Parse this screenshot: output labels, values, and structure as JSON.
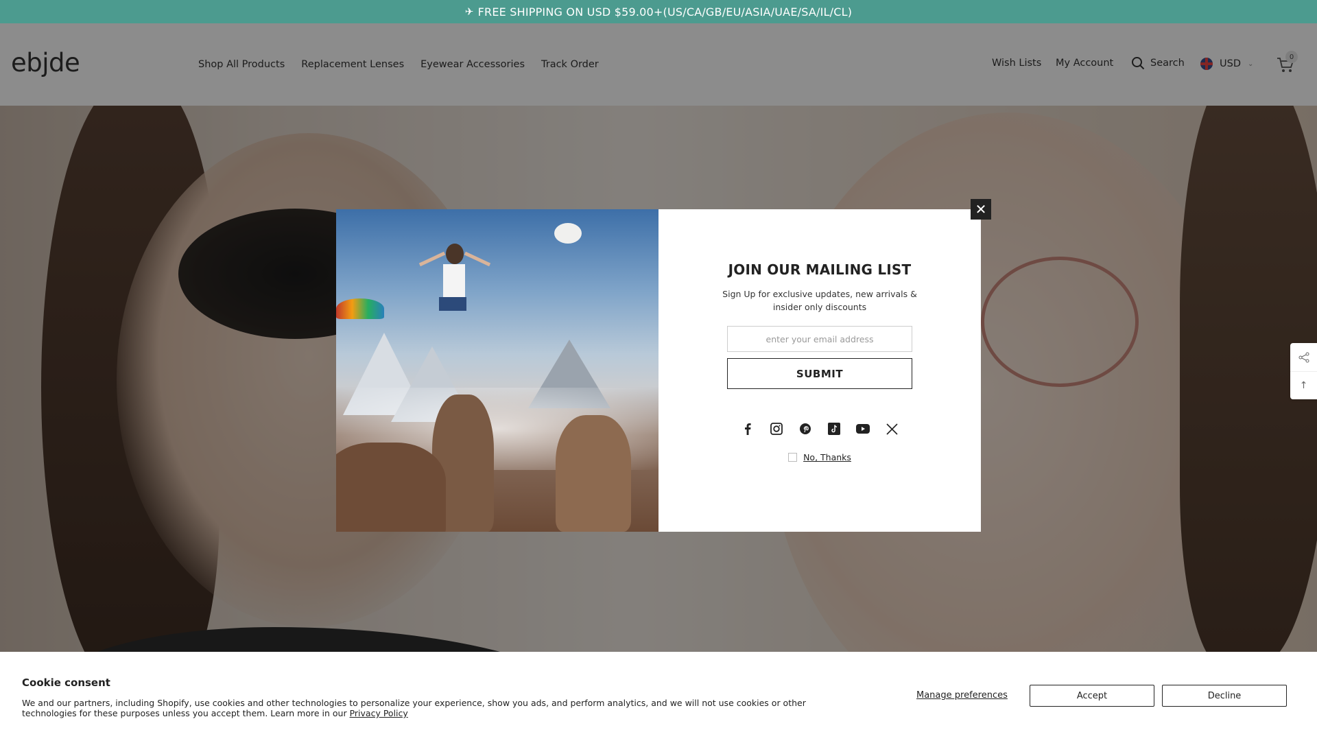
{
  "announcement": {
    "icon": "airplane-icon",
    "text": "FREE SHIPPING ON USD $59.00+(US/CA/GB/EU/ASIA/UAE/SA/IL/CL)"
  },
  "header": {
    "logo": "ebjde",
    "nav": [
      "Shop All Products",
      "Replacement Lenses",
      "Eyewear Accessories",
      "Track Order"
    ],
    "wish_lists": "Wish Lists",
    "my_account": "My Account",
    "search": "Search",
    "currency": "USD",
    "cart_count": "0"
  },
  "popup": {
    "title": "JOIN OUR MAILING LIST",
    "subtitle": "Sign Up for exclusive updates, new arrivals & insider only discounts",
    "email_placeholder": "enter your email address",
    "submit": "SUBMIT",
    "socials": [
      "facebook-icon",
      "instagram-icon",
      "pinterest-icon",
      "tiktok-icon",
      "youtube-icon",
      "x-icon"
    ],
    "no_thanks": "No, Thanks"
  },
  "cookie": {
    "title": "Cookie consent",
    "text": "We and our partners, including Shopify, use cookies and other technologies to personalize your experience, show you ads, and perform analytics, and we will not use cookies or other technologies for these purposes unless you accept them. Learn more in our",
    "privacy_link": "Privacy Policy",
    "manage": "Manage preferences",
    "accept": "Accept",
    "decline": "Decline"
  },
  "colors": {
    "announcement_bg": "#4c9b8f",
    "overlay": "rgba(0,0,0,0.45)"
  }
}
